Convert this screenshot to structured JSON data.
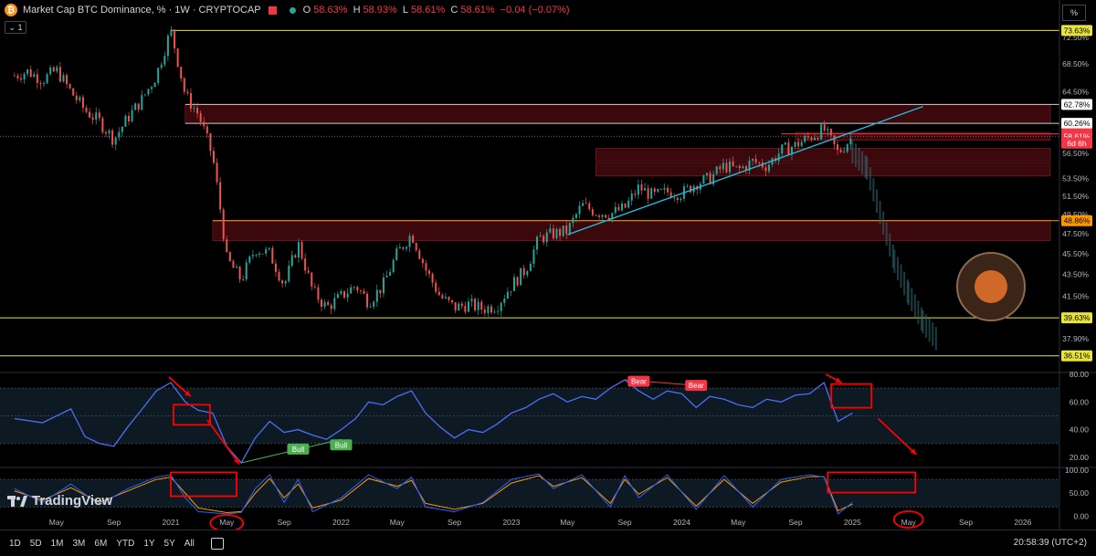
{
  "header": {
    "symbol": "Market Cap BTC Dominance, %",
    "interval_exchange": "· 1W · CRYPTOCAP",
    "btc_glyph": "₿",
    "open_label": "O",
    "open_value": "58.63%",
    "high_label": "H",
    "high_value": "58.93%",
    "low_label": "L",
    "low_value": "58.61%",
    "close_label": "C",
    "close_value": "58.61%",
    "change": "−0.04 (−0.07%)",
    "pane_count": "1",
    "scale_mode": "%"
  },
  "colors": {
    "up": "#26a69a",
    "down": "#ef5350",
    "rsi": "#4c6ef5",
    "stoch_k": "#2962ff",
    "stoch_d": "#ff9800",
    "yellow_line": "#e8e33f",
    "zone": "#5a0d12",
    "trend": "#22b8d8",
    "annot": "#ff0000",
    "bull": "#4caf50",
    "bear": "#f23645"
  },
  "chart_data": [
    {
      "type": "candlestick",
      "series": [
        {
          "name": "Market Cap BTC Dominance, %"
        }
      ],
      "ylim": [
        35.5,
        75.0
      ],
      "y_scale": "log",
      "price_ticks": [
        "72.50%",
        "68.50%",
        "64.50%",
        "56.50%",
        "53.50%",
        "51.50%",
        "49.50%",
        "47.50%",
        "45.50%",
        "43.50%",
        "41.50%",
        "37.90%"
      ],
      "price_labels": [
        {
          "text": "73.63%",
          "value": 73.63,
          "style": "yellow"
        },
        {
          "text": "62.78%",
          "value": 62.78,
          "style": "white"
        },
        {
          "text": "60.26%",
          "value": 60.26,
          "style": "white"
        },
        {
          "text": "58.92%",
          "value": 58.92,
          "style": "red"
        },
        {
          "text": "58.61%",
          "value": 58.61,
          "style": "red"
        },
        {
          "text": "6d 6h",
          "value": 57.75,
          "style": "red-sub"
        },
        {
          "text": "48.86%",
          "value": 48.86,
          "style": "orange"
        },
        {
          "text": "39.63%",
          "value": 39.63,
          "style": "yellow"
        },
        {
          "text": "36.51%",
          "value": 36.51,
          "style": "yellow"
        }
      ],
      "x_ticks": [
        {
          "label": "May",
          "date": "2020-05"
        },
        {
          "label": "Sep",
          "date": "2020-09"
        },
        {
          "label": "2021",
          "date": "2021-01"
        },
        {
          "label": "May",
          "date": "2021-05"
        },
        {
          "label": "Sep",
          "date": "2021-09"
        },
        {
          "label": "2022",
          "date": "2022-01"
        },
        {
          "label": "May",
          "date": "2022-05"
        },
        {
          "label": "Sep",
          "date": "2022-09"
        },
        {
          "label": "2023",
          "date": "2023-01"
        },
        {
          "label": "May",
          "date": "2023-05"
        },
        {
          "label": "Sep",
          "date": "2023-09"
        },
        {
          "label": "2024",
          "date": "2024-01"
        },
        {
          "label": "May",
          "date": "2024-05"
        },
        {
          "label": "Sep",
          "date": "2024-09"
        },
        {
          "label": "2025",
          "date": "2025-01"
        },
        {
          "label": "May",
          "date": "2025-05"
        },
        {
          "label": "Sep",
          "date": "2025-09"
        },
        {
          "label": "2026",
          "date": "2026-01"
        }
      ],
      "close_path": [
        [
          "2020-02",
          66.8
        ],
        [
          "2020-03",
          67.4
        ],
        [
          "2020-04",
          66.2
        ],
        [
          "2020-05",
          67.6
        ],
        [
          "2020-06",
          64.5
        ],
        [
          "2020-07",
          62.0
        ],
        [
          "2020-08",
          60.5
        ],
        [
          "2020-09",
          58.2
        ],
        [
          "2020-10",
          61.0
        ],
        [
          "2020-11",
          63.5
        ],
        [
          "2020-12",
          66.8
        ],
        [
          "2021-01",
          73.6
        ],
        [
          "2021-02",
          64.0
        ],
        [
          "2021-03",
          61.5
        ],
        [
          "2021-04",
          56.0
        ],
        [
          "2021-05",
          45.0
        ],
        [
          "2021-06",
          43.0
        ],
        [
          "2021-07",
          46.0
        ],
        [
          "2021-08",
          45.5
        ],
        [
          "2021-09",
          42.5
        ],
        [
          "2021-10",
          46.5
        ],
        [
          "2021-11",
          42.0
        ],
        [
          "2021-12",
          40.5
        ],
        [
          "2022-01",
          41.5
        ],
        [
          "2022-02",
          42.5
        ],
        [
          "2022-03",
          41.0
        ],
        [
          "2022-04",
          42.5
        ],
        [
          "2022-05",
          45.5
        ],
        [
          "2022-06",
          47.5
        ],
        [
          "2022-07",
          44.0
        ],
        [
          "2022-08",
          41.5
        ],
        [
          "2022-09",
          40.5
        ],
        [
          "2022-10",
          40.8
        ],
        [
          "2022-11",
          40.4
        ],
        [
          "2022-12",
          40.7
        ],
        [
          "2023-01",
          42.5
        ],
        [
          "2023-02",
          44.0
        ],
        [
          "2023-03",
          47.0
        ],
        [
          "2023-04",
          47.5
        ],
        [
          "2023-05",
          47.8
        ],
        [
          "2023-06",
          50.5
        ],
        [
          "2023-07",
          49.8
        ],
        [
          "2023-08",
          49.6
        ],
        [
          "2023-09",
          50.2
        ],
        [
          "2023-10",
          52.5
        ],
        [
          "2023-11",
          51.5
        ],
        [
          "2023-12",
          52.0
        ],
        [
          "2024-01",
          51.8
        ],
        [
          "2024-02",
          53.0
        ],
        [
          "2024-03",
          53.5
        ],
        [
          "2024-04",
          55.0
        ],
        [
          "2024-05",
          54.5
        ],
        [
          "2024-06",
          55.5
        ],
        [
          "2024-07",
          55.0
        ],
        [
          "2024-08",
          56.8
        ],
        [
          "2024-09",
          57.5
        ],
        [
          "2024-10",
          58.5
        ],
        [
          "2024-11",
          59.5
        ],
        [
          "2024-12",
          56.5
        ],
        [
          "2025-01",
          58.61
        ]
      ],
      "projection": [
        [
          "2025-01",
          57.0
        ],
        [
          "2025-02",
          55.0
        ],
        [
          "2025-03",
          50.0
        ],
        [
          "2025-04",
          45.0
        ],
        [
          "2025-05",
          42.0
        ],
        [
          "2025-06",
          39.5
        ],
        [
          "2025-07",
          38.0
        ]
      ],
      "horizontal_lines": [
        {
          "value": 73.63,
          "style": "yellow",
          "from": "2021-01"
        },
        {
          "value": 62.78,
          "style": "white",
          "from": "2021-02"
        },
        {
          "value": 60.26,
          "style": "white",
          "from": "2021-02"
        },
        {
          "value": 58.92,
          "style": "red",
          "from": "2024-08"
        },
        {
          "value": 48.86,
          "style": "orange",
          "from": "2021-04"
        },
        {
          "value": 39.63,
          "style": "yellow",
          "from": "2020-01"
        },
        {
          "value": 36.51,
          "style": "yellow",
          "from": "2020-01"
        }
      ],
      "zones": [
        {
          "from": "2021-02",
          "to": "2026-03",
          "low": 60.26,
          "high": 62.78
        },
        {
          "from": "2024-09",
          "to": "2026-03",
          "low": 58.1,
          "high": 59.1
        },
        {
          "from": "2023-07",
          "to": "2026-03",
          "low": 55.6,
          "high": 57.1
        },
        {
          "from": "2023-07",
          "to": "2026-03",
          "low": 53.8,
          "high": 55.4
        },
        {
          "from": "2021-04",
          "to": "2026-03",
          "low": 46.8,
          "high": 48.9
        }
      ],
      "trendline": {
        "from": [
          "2023-05",
          47.4
        ],
        "to": [
          "2025-06",
          62.5
        ]
      }
    },
    {
      "type": "line",
      "series": [],
      "ylim": [
        14,
        80
      ],
      "y_ticks": [
        "80.00",
        "60.00",
        "40.00",
        "20.00"
      ],
      "bands": [
        70,
        50,
        30
      ],
      "points": [
        [
          "2020-02",
          48
        ],
        [
          "2020-04",
          45
        ],
        [
          "2020-06",
          55
        ],
        [
          "2020-07",
          35
        ],
        [
          "2020-08",
          30
        ],
        [
          "2020-09",
          28
        ],
        [
          "2020-10",
          42
        ],
        [
          "2020-11",
          55
        ],
        [
          "2020-12",
          68
        ],
        [
          "2021-01",
          74
        ],
        [
          "2021-02",
          60
        ],
        [
          "2021-03",
          54
        ],
        [
          "2021-04",
          52
        ],
        [
          "2021-05",
          28
        ],
        [
          "2021-06",
          16
        ],
        [
          "2021-07",
          34
        ],
        [
          "2021-08",
          46
        ],
        [
          "2021-09",
          38
        ],
        [
          "2021-10",
          40
        ],
        [
          "2021-11",
          36
        ],
        [
          "2021-12",
          33
        ],
        [
          "2022-01",
          40
        ],
        [
          "2022-02",
          48
        ],
        [
          "2022-03",
          60
        ],
        [
          "2022-04",
          58
        ],
        [
          "2022-05",
          64
        ],
        [
          "2022-06",
          68
        ],
        [
          "2022-07",
          52
        ],
        [
          "2022-08",
          42
        ],
        [
          "2022-09",
          34
        ],
        [
          "2022-10",
          40
        ],
        [
          "2022-11",
          38
        ],
        [
          "2022-12",
          44
        ],
        [
          "2023-01",
          52
        ],
        [
          "2023-02",
          56
        ],
        [
          "2023-03",
          62
        ],
        [
          "2023-04",
          66
        ],
        [
          "2023-05",
          60
        ],
        [
          "2023-06",
          64
        ],
        [
          "2023-07",
          62
        ],
        [
          "2023-08",
          70
        ],
        [
          "2023-09",
          76
        ],
        [
          "2023-10",
          68
        ],
        [
          "2023-11",
          62
        ],
        [
          "2023-12",
          68
        ],
        [
          "2024-01",
          66
        ],
        [
          "2024-02",
          56
        ],
        [
          "2024-03",
          64
        ],
        [
          "2024-04",
          62
        ],
        [
          "2024-05",
          58
        ],
        [
          "2024-06",
          56
        ],
        [
          "2024-07",
          62
        ],
        [
          "2024-08",
          60
        ],
        [
          "2024-09",
          65
        ],
        [
          "2024-10",
          66
        ],
        [
          "2024-11",
          74
        ],
        [
          "2024-12",
          46
        ],
        [
          "2025-01",
          52
        ]
      ],
      "labels": [
        {
          "text": "Bull",
          "date": "2021-10",
          "value": 26,
          "kind": "bull"
        },
        {
          "text": "Bull",
          "date": "2022-01",
          "value": 29,
          "kind": "bull"
        },
        {
          "text": "Bear",
          "date": "2023-10",
          "value": 75,
          "kind": "bear"
        },
        {
          "text": "Bear",
          "date": "2024-02",
          "value": 72,
          "kind": "bear"
        }
      ]
    },
    {
      "type": "line",
      "series": [],
      "ylim": [
        -5,
        100
      ],
      "y_ticks": [
        "100.00",
        "50.00",
        "0.00"
      ],
      "bands": [
        80,
        20
      ],
      "k_points": [
        [
          "2020-02",
          60
        ],
        [
          "2020-04",
          30
        ],
        [
          "2020-06",
          70
        ],
        [
          "2020-08",
          25
        ],
        [
          "2020-10",
          60
        ],
        [
          "2020-12",
          85
        ],
        [
          "2021-01",
          90
        ],
        [
          "2021-02",
          40
        ],
        [
          "2021-03",
          10
        ],
        [
          "2021-05",
          5
        ],
        [
          "2021-06",
          8
        ],
        [
          "2021-07",
          60
        ],
        [
          "2021-08",
          90
        ],
        [
          "2021-09",
          30
        ],
        [
          "2021-10",
          80
        ],
        [
          "2021-11",
          10
        ],
        [
          "2022-01",
          40
        ],
        [
          "2022-03",
          90
        ],
        [
          "2022-05",
          60
        ],
        [
          "2022-06",
          85
        ],
        [
          "2022-07",
          20
        ],
        [
          "2022-09",
          10
        ],
        [
          "2022-11",
          30
        ],
        [
          "2023-01",
          80
        ],
        [
          "2023-03",
          92
        ],
        [
          "2023-04",
          60
        ],
        [
          "2023-06",
          90
        ],
        [
          "2023-08",
          20
        ],
        [
          "2023-09",
          88
        ],
        [
          "2023-10",
          40
        ],
        [
          "2023-12",
          90
        ],
        [
          "2024-02",
          15
        ],
        [
          "2024-04",
          88
        ],
        [
          "2024-06",
          20
        ],
        [
          "2024-08",
          80
        ],
        [
          "2024-10",
          90
        ],
        [
          "2024-11",
          85
        ],
        [
          "2024-12",
          5
        ],
        [
          "2025-01",
          30
        ]
      ],
      "d_points": [
        [
          "2020-02",
          55
        ],
        [
          "2020-04",
          35
        ],
        [
          "2020-06",
          62
        ],
        [
          "2020-08",
          30
        ],
        [
          "2020-10",
          55
        ],
        [
          "2020-12",
          80
        ],
        [
          "2021-01",
          85
        ],
        [
          "2021-02",
          50
        ],
        [
          "2021-03",
          18
        ],
        [
          "2021-05",
          8
        ],
        [
          "2021-06",
          10
        ],
        [
          "2021-07",
          50
        ],
        [
          "2021-08",
          82
        ],
        [
          "2021-09",
          40
        ],
        [
          "2021-10",
          70
        ],
        [
          "2021-11",
          18
        ],
        [
          "2022-01",
          35
        ],
        [
          "2022-03",
          82
        ],
        [
          "2022-05",
          65
        ],
        [
          "2022-06",
          78
        ],
        [
          "2022-07",
          28
        ],
        [
          "2022-09",
          15
        ],
        [
          "2022-11",
          28
        ],
        [
          "2023-01",
          72
        ],
        [
          "2023-03",
          88
        ],
        [
          "2023-04",
          65
        ],
        [
          "2023-06",
          84
        ],
        [
          "2023-08",
          28
        ],
        [
          "2023-09",
          80
        ],
        [
          "2023-10",
          48
        ],
        [
          "2023-12",
          84
        ],
        [
          "2024-02",
          22
        ],
        [
          "2024-04",
          80
        ],
        [
          "2024-06",
          28
        ],
        [
          "2024-08",
          74
        ],
        [
          "2024-10",
          86
        ],
        [
          "2024-11",
          86
        ],
        [
          "2024-12",
          12
        ],
        [
          "2025-01",
          26
        ]
      ]
    }
  ],
  "timeframes": [
    "1D",
    "5D",
    "1M",
    "3M",
    "6M",
    "YTD",
    "1Y",
    "5Y",
    "All"
  ],
  "clock": "20:58:39 (UTC+2)",
  "brand": "TradingView"
}
